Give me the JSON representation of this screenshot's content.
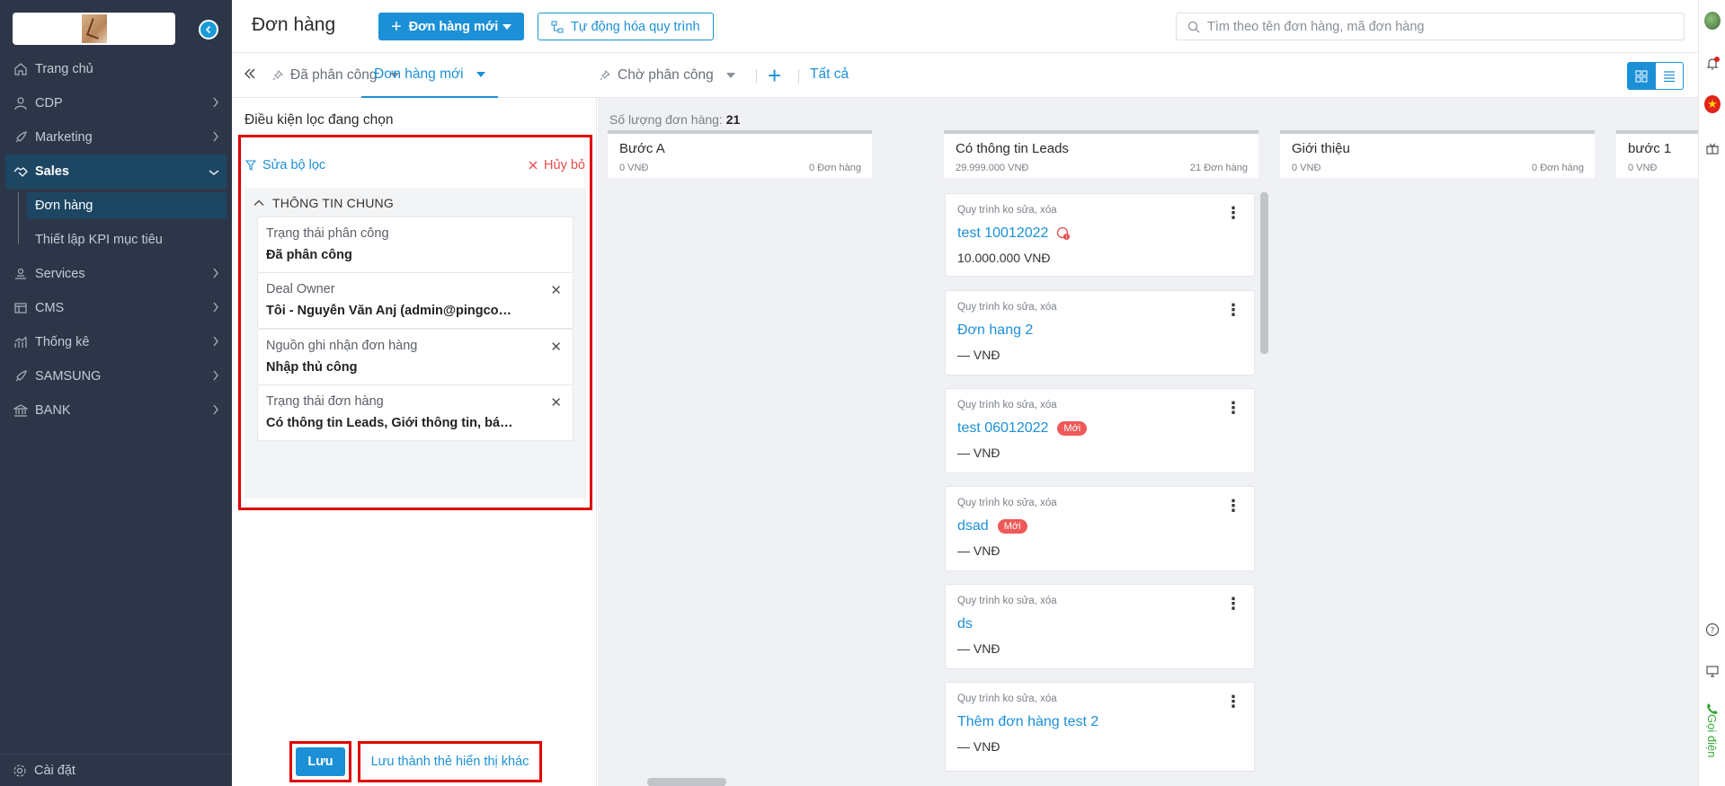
{
  "sidebar": {
    "logo_alt": "logo",
    "items": [
      {
        "label": "Trang chủ",
        "icon": "home-icon",
        "has_children": false
      },
      {
        "label": "CDP",
        "icon": "user-icon",
        "has_children": true
      },
      {
        "label": "Marketing",
        "icon": "rocket-icon",
        "has_children": true
      },
      {
        "label": "Sales",
        "icon": "handshake-icon",
        "has_children": true,
        "expanded": true
      },
      {
        "label": "Services",
        "icon": "service-icon",
        "has_children": true
      },
      {
        "label": "CMS",
        "icon": "cms-icon",
        "has_children": true
      },
      {
        "label": "Thống kê",
        "icon": "chart-icon",
        "has_children": true
      },
      {
        "label": "SAMSUNG",
        "icon": "rocket-icon",
        "has_children": true
      },
      {
        "label": "BANK",
        "icon": "bank-icon",
        "has_children": true
      }
    ],
    "sales_children": [
      "Đơn hàng",
      "Thiết lập KPI mục tiêu"
    ],
    "settings_label": "Cài đặt"
  },
  "header": {
    "title": "Đơn hàng",
    "new_button": "Đơn hàng mới",
    "automation_button": "Tự động hóa quy trình",
    "search_placeholder": "Tìm theo tên đơn hàng, mã đơn hàng"
  },
  "tabs": {
    "items": [
      "Đã phân công",
      "Đơn hàng mới",
      "Chờ phân công"
    ],
    "active": "Đơn hàng mới",
    "all_label": "Tất cả"
  },
  "filter": {
    "title": "Điều kiện lọc đang chọn",
    "edit_label": "Sửa bộ lọc",
    "cancel_label": "Hủy bỏ",
    "group_title": "THÔNG TIN CHUNG",
    "conditions": [
      {
        "label": "Trạng thái phân công",
        "value": "Đã phân công",
        "removable": false
      },
      {
        "label": "Deal Owner",
        "value": "Tôi - Nguyễn Văn Anj (admin@pingcom...",
        "removable": true
      },
      {
        "label": "Nguồn ghi nhận đơn hàng",
        "value": "Nhập thủ công",
        "removable": true
      },
      {
        "label": "Trạng thái đơn hàng",
        "value": "Có thông tin Leads, Giới thông tin, báo ...",
        "removable": true
      }
    ],
    "save_label": "Lưu",
    "save_as_label": "Lưu thành thẻ hiển thị khác"
  },
  "board": {
    "count_label": "Số lượng đơn hàng:",
    "count_value": "21",
    "columns": [
      {
        "name": "Bước A",
        "amount": "0 VNĐ",
        "count": "0 Đơn hàng"
      },
      {
        "name": "Có thông tin Leads",
        "amount": "29.999.000 VNĐ",
        "count": "21 Đơn hàng"
      },
      {
        "name": "Giới thiệu",
        "amount": "0 VNĐ",
        "count": "0 Đơn hàng"
      },
      {
        "name": "bước 1",
        "amount": "0 VNĐ",
        "count": ""
      }
    ],
    "cards": [
      {
        "process": "Quy trình ko sửa, xóa",
        "title": "test 10012022",
        "price": "10.000.000 VNĐ",
        "badge": "",
        "warn": true
      },
      {
        "process": "Quy trình ko sửa, xóa",
        "title": "Đơn hang 2",
        "price": "— VNĐ",
        "badge": "",
        "warn": false
      },
      {
        "process": "Quy trình ko sửa, xóa",
        "title": "test 06012022",
        "price": "— VNĐ",
        "badge": "Mới",
        "warn": false
      },
      {
        "process": "Quy trình ko sửa, xóa",
        "title": "dsad",
        "price": "— VNĐ",
        "badge": "Mới",
        "warn": false
      },
      {
        "process": "Quy trình ko sửa, xóa",
        "title": "ds",
        "price": "— VNĐ",
        "badge": "",
        "warn": false
      },
      {
        "process": "Quy trình ko sửa, xóa",
        "title": "Thêm đơn hàng test 2",
        "price": "— VNĐ",
        "badge": "",
        "warn": false
      }
    ]
  },
  "rail": {
    "call_label": "Gọi điện"
  },
  "colors": {
    "primary": "#1b90d6",
    "sidebar_bg": "#2c3648",
    "highlight_box": "#e00000",
    "badge": "#ef5959"
  }
}
